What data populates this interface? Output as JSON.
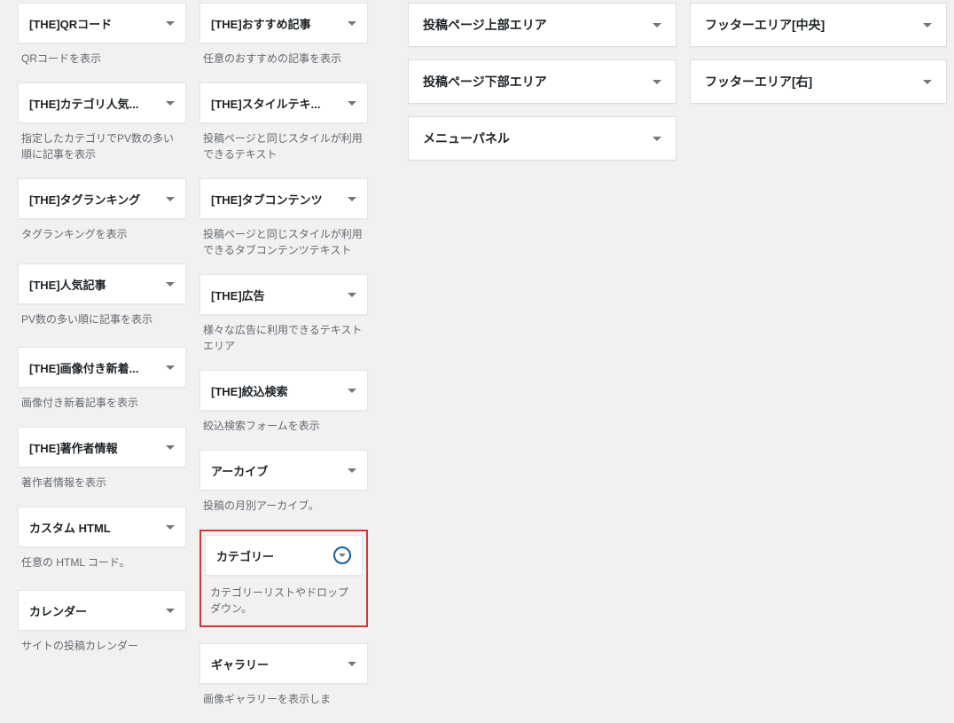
{
  "widgets_col1": [
    {
      "title": "[THE]QRコード",
      "desc": "QRコードを表示"
    },
    {
      "title": "[THE]カテゴリ人気...",
      "desc": "指定したカテゴリでPV数の多い順に記事を表示"
    },
    {
      "title": "[THE]タグランキング",
      "desc": "タグランキングを表示"
    },
    {
      "title": "[THE]人気記事",
      "desc": "PV数の多い順に記事を表示"
    },
    {
      "title": "[THE]画像付き新着...",
      "desc": "画像付き新着記事を表示"
    },
    {
      "title": "[THE]著作者情報",
      "desc": "著作者情報を表示"
    },
    {
      "title": "カスタム HTML",
      "desc": "任意の HTML コード。"
    },
    {
      "title": "カレンダー",
      "desc": "サイトの投稿カレンダー"
    }
  ],
  "widgets_col2": [
    {
      "title": "[THE]おすすめ記事",
      "desc": "任意のおすすめの記事を表示"
    },
    {
      "title": "[THE]スタイルテキ...",
      "desc": "投稿ページと同じスタイルが利用できるテキスト"
    },
    {
      "title": "[THE]タブコンテンツ",
      "desc": "投稿ページと同じスタイルが利用できるタブコンテンツテキスト"
    },
    {
      "title": "[THE]広告",
      "desc": "様々な広告に利用できるテキストエリア"
    },
    {
      "title": "[THE]絞込検索",
      "desc": "絞込検索フォームを表示"
    },
    {
      "title": "アーカイブ",
      "desc": "投稿の月別アーカイブ。"
    }
  ],
  "highlighted_widget": {
    "title": "カテゴリー",
    "desc": "カテゴリーリストやドロップダウン。"
  },
  "widgets_col2_after": [
    {
      "title": "ギャラリー",
      "desc": "画像ギャラリーを表示しま"
    }
  ],
  "areas_col3": [
    {
      "title": "投稿ページ上部エリア"
    },
    {
      "title": "投稿ページ下部エリア"
    },
    {
      "title": "メニューパネル"
    }
  ],
  "areas_col4": [
    {
      "title": "フッターエリア[中央]"
    },
    {
      "title": "フッターエリア[右]"
    }
  ]
}
